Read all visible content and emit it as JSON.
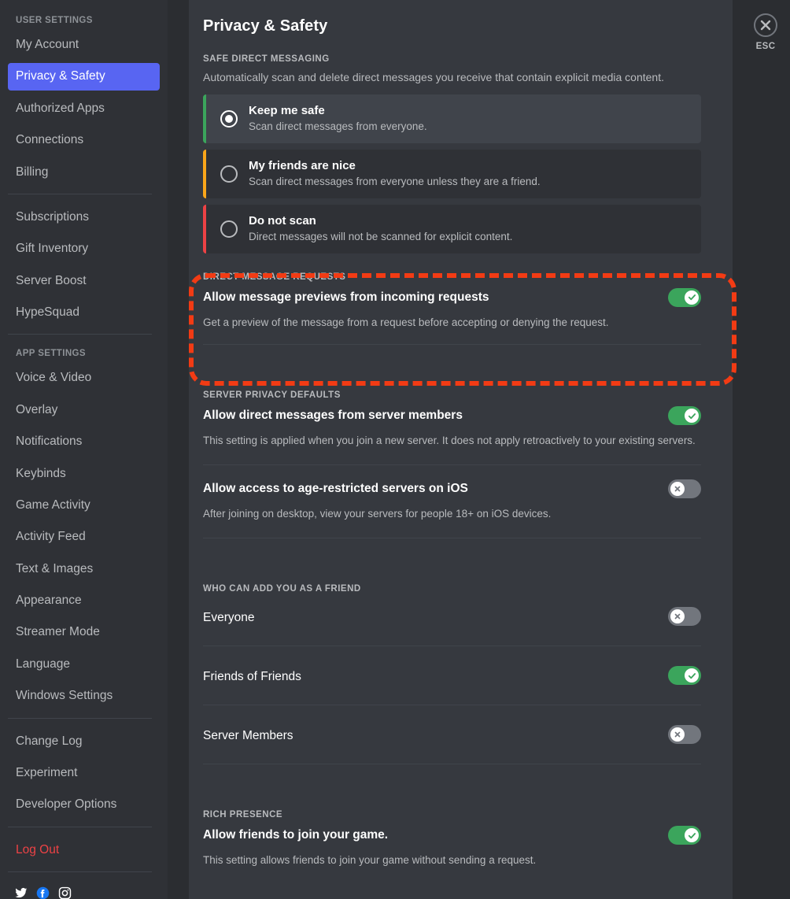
{
  "sidebar": {
    "groups": [
      {
        "header": "USER SETTINGS",
        "items": [
          {
            "label": "My Account",
            "active": false
          },
          {
            "label": "Privacy & Safety",
            "active": true
          },
          {
            "label": "Authorized Apps",
            "active": false
          },
          {
            "label": "Connections",
            "active": false
          },
          {
            "label": "Billing",
            "active": false
          }
        ]
      },
      {
        "header": "",
        "items": [
          {
            "label": "Subscriptions",
            "active": false
          },
          {
            "label": "Gift Inventory",
            "active": false
          },
          {
            "label": "Server Boost",
            "active": false
          },
          {
            "label": "HypeSquad",
            "active": false
          }
        ]
      },
      {
        "header": "APP SETTINGS",
        "items": [
          {
            "label": "Voice & Video",
            "active": false
          },
          {
            "label": "Overlay",
            "active": false
          },
          {
            "label": "Notifications",
            "active": false
          },
          {
            "label": "Keybinds",
            "active": false
          },
          {
            "label": "Game Activity",
            "active": false
          },
          {
            "label": "Activity Feed",
            "active": false
          },
          {
            "label": "Text & Images",
            "active": false
          },
          {
            "label": "Appearance",
            "active": false
          },
          {
            "label": "Streamer Mode",
            "active": false
          },
          {
            "label": "Language",
            "active": false
          },
          {
            "label": "Windows Settings",
            "active": false
          }
        ]
      },
      {
        "header": "",
        "items": [
          {
            "label": "Change Log",
            "active": false
          },
          {
            "label": "Experiment",
            "active": false
          },
          {
            "label": "Developer Options",
            "active": false
          }
        ]
      }
    ],
    "logout_label": "Log Out",
    "socials": [
      {
        "name": "twitter-icon"
      },
      {
        "name": "facebook-icon"
      },
      {
        "name": "instagram-icon"
      }
    ]
  },
  "header": {
    "title": "Privacy & Safety",
    "close_label": "ESC"
  },
  "safe_dm": {
    "section_title": "SAFE DIRECT MESSAGING",
    "description": "Automatically scan and delete direct messages you receive that contain explicit media content.",
    "options": [
      {
        "title": "Keep me safe",
        "subtitle": "Scan direct messages from everyone.",
        "selected": true,
        "accent": "#3ba55c"
      },
      {
        "title": "My friends are nice",
        "subtitle": "Scan direct messages from everyone unless they are a friend.",
        "selected": false,
        "accent": "#faa61a"
      },
      {
        "title": "Do not scan",
        "subtitle": "Direct messages will not be scanned for explicit content.",
        "selected": false,
        "accent": "#ed4245"
      }
    ]
  },
  "dm_requests": {
    "section_title": "DIRECT MESSAGE REQUESTS",
    "label": "Allow message previews from incoming requests",
    "description": "Get a preview of the message from a request before accepting or denying the request.",
    "toggle_on": true
  },
  "server_privacy": {
    "section_title": "SERVER PRIVACY DEFAULTS",
    "rows": [
      {
        "label": "Allow direct messages from server members",
        "description": "This setting is applied when you join a new server. It does not apply retroactively to your existing servers.",
        "toggle_on": true
      },
      {
        "label": "Allow access to age-restricted servers on iOS",
        "description": "After joining on desktop, view your servers for people 18+ on iOS devices.",
        "toggle_on": false
      }
    ]
  },
  "who_can_add": {
    "section_title": "WHO CAN ADD YOU AS A FRIEND",
    "rows": [
      {
        "label": "Everyone",
        "toggle_on": false
      },
      {
        "label": "Friends of Friends",
        "toggle_on": true
      },
      {
        "label": "Server Members",
        "toggle_on": false
      }
    ]
  },
  "rich_presence": {
    "section_title": "RICH PRESENCE",
    "label": "Allow friends to join your game.",
    "description": "This setting allows friends to join your game without sending a request.",
    "toggle_on": true
  },
  "annotation": {
    "color": "#f23b14",
    "target": "Allow message previews from incoming requests"
  },
  "colors": {
    "accent_active": "#5865f2",
    "toggle_on": "#3ba55c",
    "toggle_off": "#72767d",
    "sidebar_bg": "#2f3136",
    "content_bg": "#36393f",
    "danger": "#ed4245"
  }
}
